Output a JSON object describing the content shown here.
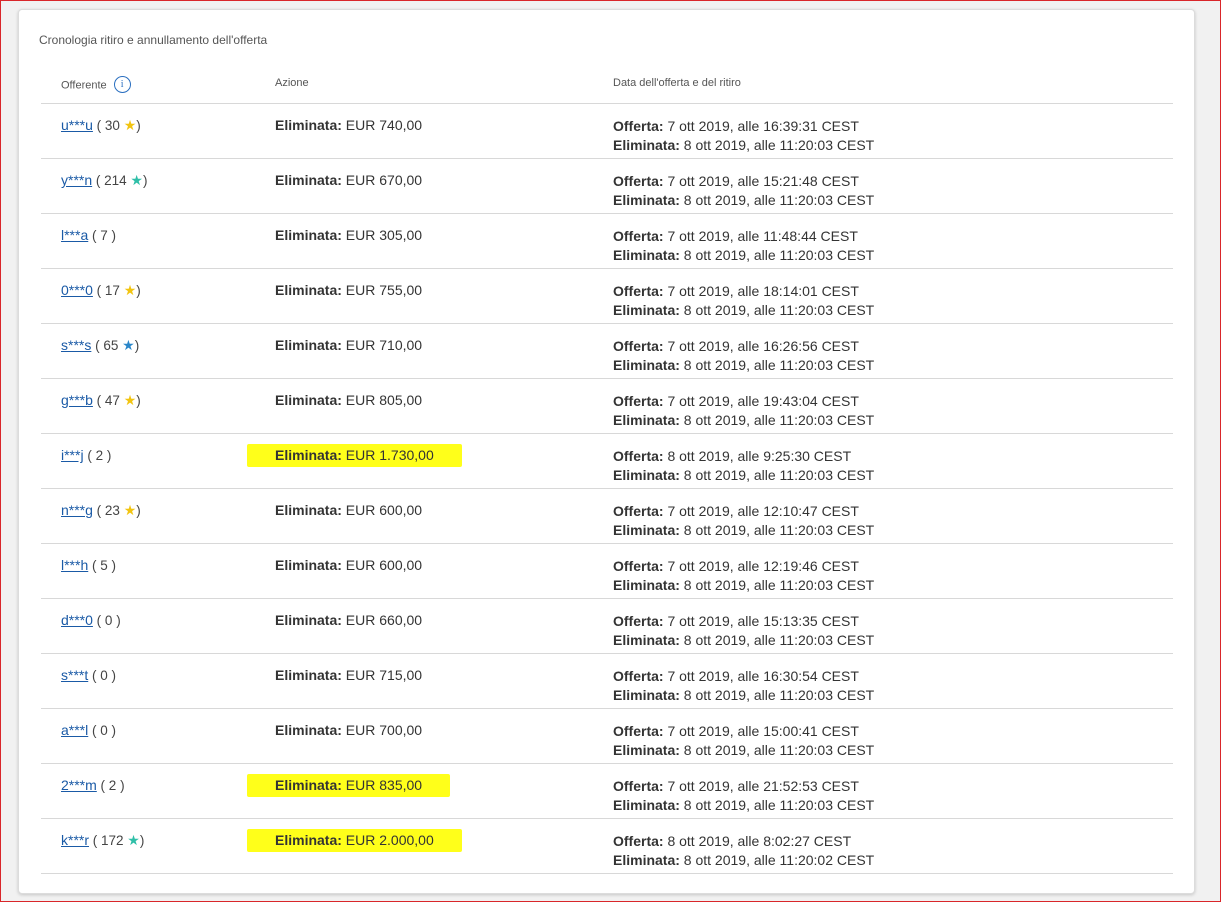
{
  "title": "Cronologia ritiro e annullamento dell'offerta",
  "headers": {
    "bidder": "Offerente",
    "info": "i",
    "action": "Azione",
    "dates": "Data dell'offerta e del ritiro"
  },
  "labels": {
    "deleted": "Eliminata:",
    "offer": "Offerta:"
  },
  "colors": {
    "star_yellow": "#f2c410",
    "star_turquoise": "#2fbfa8",
    "star_blue": "#2a86c9",
    "highlight": "#ffff1a",
    "link": "#1a5aa6"
  },
  "rows": [
    {
      "bidder": "u***u",
      "open": " ( 30 ",
      "star": "yellow",
      "close": ")",
      "amount": "EUR 740,00",
      "offer": "7 ott 2019, alle 16:39:31 CEST",
      "deleted": "8 ott 2019, alle 11:20:03 CEST",
      "highlight": false
    },
    {
      "bidder": "y***n",
      "open": " ( 214 ",
      "star": "turquoise",
      "close": ")",
      "amount": "EUR 670,00",
      "offer": "7 ott 2019, alle 15:21:48 CEST",
      "deleted": "8 ott 2019, alle 11:20:03 CEST",
      "highlight": false
    },
    {
      "bidder": "l***a",
      "open": " ( 7 ",
      "star": "",
      "close": ")",
      "amount": "EUR 305,00",
      "offer": "7 ott 2019, alle 11:48:44 CEST",
      "deleted": "8 ott 2019, alle 11:20:03 CEST",
      "highlight": false
    },
    {
      "bidder": "0***0",
      "open": " ( 17 ",
      "star": "yellow",
      "close": ")",
      "amount": "EUR 755,00",
      "offer": "7 ott 2019, alle 18:14:01 CEST",
      "deleted": "8 ott 2019, alle 11:20:03 CEST",
      "highlight": false
    },
    {
      "bidder": "s***s",
      "open": " ( 65 ",
      "star": "blue",
      "close": ")",
      "amount": "EUR 710,00",
      "offer": "7 ott 2019, alle 16:26:56 CEST",
      "deleted": "8 ott 2019, alle 11:20:03 CEST",
      "highlight": false
    },
    {
      "bidder": "g***b",
      "open": " ( 47 ",
      "star": "yellow",
      "close": ")",
      "amount": "EUR 805,00",
      "offer": "7 ott 2019, alle 19:43:04 CEST",
      "deleted": "8 ott 2019, alle 11:20:03 CEST",
      "highlight": false
    },
    {
      "bidder": "i***j",
      "open": " ( 2 ",
      "star": "",
      "close": ")",
      "amount": "EUR 1.730,00",
      "offer": "8 ott 2019, alle 9:25:30 CEST",
      "deleted": "8 ott 2019, alle 11:20:03 CEST",
      "highlight": true
    },
    {
      "bidder": "n***g",
      "open": " ( 23 ",
      "star": "yellow",
      "close": ")",
      "amount": "EUR 600,00",
      "offer": "7 ott 2019, alle 12:10:47 CEST",
      "deleted": "8 ott 2019, alle 11:20:03 CEST",
      "highlight": false
    },
    {
      "bidder": "l***h",
      "open": " ( 5 ",
      "star": "",
      "close": ")",
      "amount": "EUR 600,00",
      "offer": "7 ott 2019, alle 12:19:46 CEST",
      "deleted": "8 ott 2019, alle 11:20:03 CEST",
      "highlight": false
    },
    {
      "bidder": "d***0",
      "open": " ( 0 ",
      "star": "",
      "close": ")",
      "amount": "EUR 660,00",
      "offer": "7 ott 2019, alle 15:13:35 CEST",
      "deleted": "8 ott 2019, alle 11:20:03 CEST",
      "highlight": false
    },
    {
      "bidder": "s***t",
      "open": " ( 0 ",
      "star": "",
      "close": ")",
      "amount": "EUR 715,00",
      "offer": "7 ott 2019, alle 16:30:54 CEST",
      "deleted": "8 ott 2019, alle 11:20:03 CEST",
      "highlight": false
    },
    {
      "bidder": "a***l",
      "open": " ( 0 ",
      "star": "",
      "close": ")",
      "amount": "EUR 700,00",
      "offer": "7 ott 2019, alle 15:00:41 CEST",
      "deleted": "8 ott 2019, alle 11:20:03 CEST",
      "highlight": false
    },
    {
      "bidder": "2***m",
      "open": " ( 2 ",
      "star": "",
      "close": ")",
      "amount": "EUR 835,00",
      "offer": "7 ott 2019, alle 21:52:53 CEST",
      "deleted": "8 ott 2019, alle 11:20:03 CEST",
      "highlight": true
    },
    {
      "bidder": "k***r",
      "open": " ( 172 ",
      "star": "turquoise",
      "close": ")",
      "amount": "EUR 2.000,00",
      "offer": "8 ott 2019, alle 8:02:27 CEST",
      "deleted": "8 ott 2019, alle 11:20:02 CEST",
      "highlight": true
    }
  ]
}
